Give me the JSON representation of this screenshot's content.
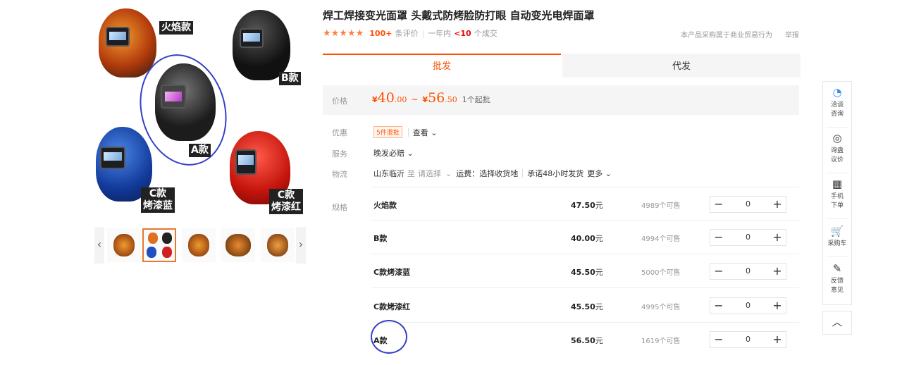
{
  "gallery": {
    "labels": {
      "flame": "火焰款",
      "b": "B款",
      "a": "A款",
      "c_blue_1": "C款",
      "c_blue_2": "烤漆蓝",
      "c_red_1": "C款",
      "c_red_2": "烤漆红"
    },
    "prev_icon": "chevron-left-icon",
    "next_icon": "chevron-right-icon",
    "prev_glyph": "‹",
    "next_glyph": "›"
  },
  "product": {
    "title": "焊工焊接变光面罩 头戴式防烤脸防打眼 自动变光电焊面罩",
    "stars": "★★★★★",
    "review_count": "100+",
    "review_label": "条评价",
    "year_label": "一年内",
    "sold_count": "<10",
    "sold_label": "个成交",
    "note": "本产品采购属于商业贸易行为",
    "report": "举报"
  },
  "tabs": [
    {
      "label": "批发"
    },
    {
      "label": "代发"
    }
  ],
  "price": {
    "label": "价格",
    "currency": "¥",
    "low_int": "40",
    "low_dec": ".00",
    "tilde": "~",
    "high_int": "56",
    "high_dec": ".50",
    "min_order": "1个起批"
  },
  "promo": {
    "label": "优惠",
    "tag": "5件混批",
    "more": "查看 ⌄"
  },
  "service": {
    "label": "服务",
    "value": "晚发必赔 ⌄"
  },
  "logistics": {
    "label": "物流",
    "origin": "山东临沂",
    "to": "至",
    "select": "请选择",
    "chev": "⌄",
    "freight": "运费：选择收货地",
    "promise": "承诺48小时发货",
    "more": "更多 ⌄"
  },
  "spec": {
    "label": "规格",
    "unit": "元",
    "stock_suffix": "个可售",
    "minus": "−",
    "plus": "+",
    "rows": [
      {
        "name": "火焰款",
        "price": "47.50",
        "stock": "4989",
        "qty": "0"
      },
      {
        "name": "B款",
        "price": "40.00",
        "stock": "4994",
        "qty": "0"
      },
      {
        "name": "C款烤漆蓝",
        "price": "45.50",
        "stock": "5000",
        "qty": "0"
      },
      {
        "name": "C款烤漆红",
        "price": "45.50",
        "stock": "4995",
        "qty": "0"
      },
      {
        "name": "A款",
        "price": "56.50",
        "stock": "1619",
        "qty": "0"
      }
    ]
  },
  "sidebar": {
    "items": [
      {
        "icon": "chat-icon",
        "glyph": "◔",
        "line1": "洽谈",
        "line2": "咨询"
      },
      {
        "icon": "target-icon",
        "glyph": "◎",
        "line1": "询盘",
        "line2": "议价"
      },
      {
        "icon": "qrcode-icon",
        "glyph": "▦",
        "line1": "手机",
        "line2": "下单"
      },
      {
        "icon": "cart-icon",
        "glyph": "🛒",
        "line1": "采购车",
        "line2": ""
      },
      {
        "icon": "edit-icon",
        "glyph": "✎",
        "line1": "反馈",
        "line2": "意见"
      }
    ],
    "top_glyph": "︿"
  }
}
